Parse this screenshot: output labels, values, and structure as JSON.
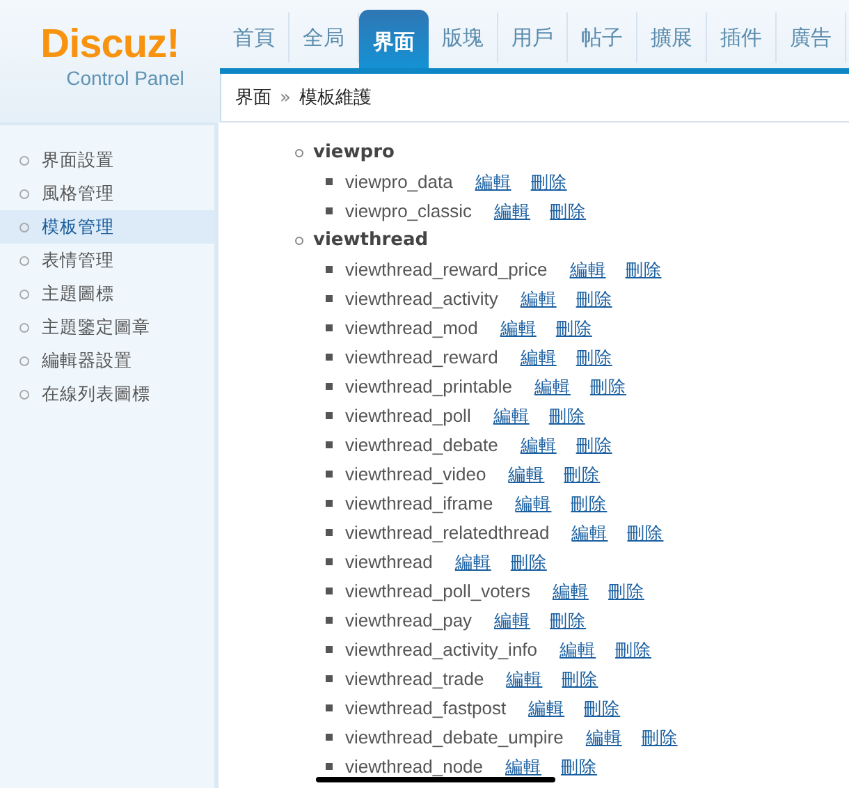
{
  "logo": {
    "brand": "Discuz!",
    "subtitle": "Control Panel"
  },
  "tabs": [
    {
      "label": "首頁",
      "selected": false
    },
    {
      "label": "全局",
      "selected": false
    },
    {
      "label": "界面",
      "selected": true
    },
    {
      "label": "版塊",
      "selected": false
    },
    {
      "label": "用戶",
      "selected": false
    },
    {
      "label": "帖子",
      "selected": false
    },
    {
      "label": "擴展",
      "selected": false
    },
    {
      "label": "插件",
      "selected": false
    },
    {
      "label": "廣告",
      "selected": false
    }
  ],
  "breadcrumb": {
    "parent": "界面",
    "separator": "»",
    "current": "模板維護"
  },
  "sidebar": {
    "items": [
      {
        "label": "界面設置",
        "selected": false
      },
      {
        "label": "風格管理",
        "selected": false
      },
      {
        "label": "模板管理",
        "selected": true
      },
      {
        "label": "表情管理",
        "selected": false
      },
      {
        "label": "主題圖標",
        "selected": false
      },
      {
        "label": "主題鑒定圖章",
        "selected": false
      },
      {
        "label": "編輯器設置",
        "selected": false
      },
      {
        "label": "在線列表圖標",
        "selected": false
      }
    ]
  },
  "tree": [
    {
      "name": "viewpro",
      "children": [
        {
          "name": "viewpro_data",
          "edit": "編輯",
          "delete": "刪除"
        },
        {
          "name": "viewpro_classic",
          "edit": "編輯",
          "delete": "刪除"
        }
      ]
    },
    {
      "name": "viewthread",
      "children": [
        {
          "name": "viewthread_reward_price",
          "edit": "編輯",
          "delete": "刪除"
        },
        {
          "name": "viewthread_activity",
          "edit": "編輯",
          "delete": "刪除"
        },
        {
          "name": "viewthread_mod",
          "edit": "編輯",
          "delete": "刪除"
        },
        {
          "name": "viewthread_reward",
          "edit": "編輯",
          "delete": "刪除"
        },
        {
          "name": "viewthread_printable",
          "edit": "編輯",
          "delete": "刪除"
        },
        {
          "name": "viewthread_poll",
          "edit": "編輯",
          "delete": "刪除"
        },
        {
          "name": "viewthread_debate",
          "edit": "編輯",
          "delete": "刪除"
        },
        {
          "name": "viewthread_video",
          "edit": "編輯",
          "delete": "刪除"
        },
        {
          "name": "viewthread_iframe",
          "edit": "編輯",
          "delete": "刪除"
        },
        {
          "name": "viewthread_relatedthread",
          "edit": "編輯",
          "delete": "刪除"
        },
        {
          "name": "viewthread",
          "edit": "編輯",
          "delete": "刪除"
        },
        {
          "name": "viewthread_poll_voters",
          "edit": "編輯",
          "delete": "刪除"
        },
        {
          "name": "viewthread_pay",
          "edit": "編輯",
          "delete": "刪除"
        },
        {
          "name": "viewthread_activity_info",
          "edit": "編輯",
          "delete": "刪除"
        },
        {
          "name": "viewthread_trade",
          "edit": "編輯",
          "delete": "刪除"
        },
        {
          "name": "viewthread_fastpost",
          "edit": "編輯",
          "delete": "刪除"
        },
        {
          "name": "viewthread_debate_umpire",
          "edit": "編輯",
          "delete": "刪除"
        },
        {
          "name": "viewthread_node",
          "edit": "編輯",
          "delete": "刪除"
        }
      ]
    }
  ]
}
